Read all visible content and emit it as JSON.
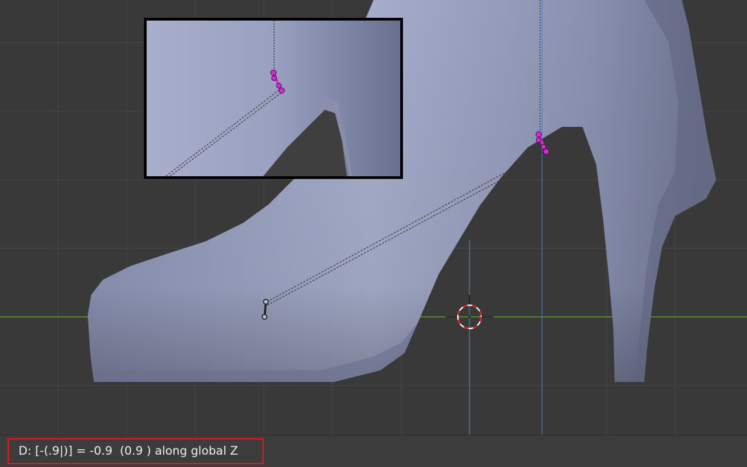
{
  "viewport": {
    "background": "#393939",
    "grid_color": "#474747",
    "x_axis_color": "#6e9a2b",
    "z_axis_color": "#4a7ec0",
    "mesh_color": "#99a0c0",
    "bone_selected_color": "#d22fd2",
    "bone_unselected_color": "#222222",
    "cursor_3d": "3d-cursor"
  },
  "inset": {
    "description_icon": "zoom-detail",
    "border_color": "#000000"
  },
  "status": {
    "text": "D: [-(.9|)] = -0.9  (0.9 ) along global Z",
    "highlight_color": "#e01818"
  }
}
